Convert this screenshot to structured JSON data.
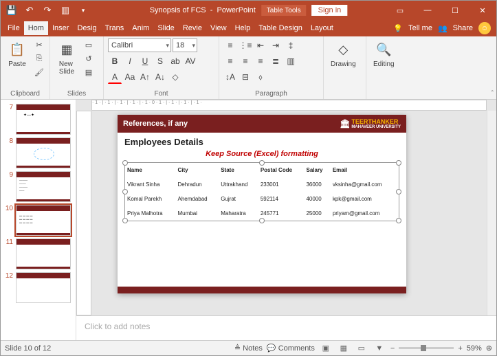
{
  "title": {
    "doc": "Synopsis of FCS",
    "app": "PowerPoint",
    "context": "Table Tools",
    "signin": "Sign in"
  },
  "tabs": [
    "File",
    "Home",
    "Insert",
    "Design",
    "Transitions",
    "Animations",
    "Slide Show",
    "Review",
    "View",
    "Help",
    "Table Design",
    "Layout"
  ],
  "tabs_short": [
    "File",
    "Hom",
    "Inser",
    "Desig",
    "Trans",
    "Anim",
    "Slide",
    "Revie",
    "View",
    "Help",
    "Table Design",
    "Layout"
  ],
  "tellme": "Tell me",
  "share": "Share",
  "ribbon": {
    "clipboard": "Clipboard",
    "paste": "Paste",
    "slides": "Slides",
    "newslide": "New\nSlide",
    "font": "Font",
    "fontname": "Calibri",
    "fontsize": "18",
    "paragraph": "Paragraph",
    "drawing": "Drawing",
    "editing": "Editing"
  },
  "thumbs": [
    7,
    8,
    9,
    10,
    11,
    12
  ],
  "current_thumb": 10,
  "slide": {
    "header": "References, if any",
    "uni": "TEERTHANKER",
    "uni2": "MAHAVEER UNIVERSITY",
    "title": "Employees Details",
    "note": "Keep Source (Excel) formatting",
    "cols": [
      "Name",
      "City",
      "State",
      "Postal Code",
      "Salary",
      "Email"
    ],
    "rows": [
      [
        "Vikrant Sinha",
        "Dehradun",
        "Uttrakhand",
        "233001",
        "36000",
        "vksinha@gmail.com"
      ],
      [
        "Komal Parekh",
        "Ahemdabad",
        "Gujrat",
        "592114",
        "40000",
        "kpk@gmail.com"
      ],
      [
        "Priya Malhotra",
        "Mumbai",
        "Maharatra",
        "245771",
        "25000",
        "priyam@gmail.com"
      ]
    ]
  },
  "notes_placeholder": "Click to add notes",
  "status": {
    "slide": "Slide 10 of 12",
    "notes": "Notes",
    "comments": "Comments",
    "zoom": "59%"
  }
}
